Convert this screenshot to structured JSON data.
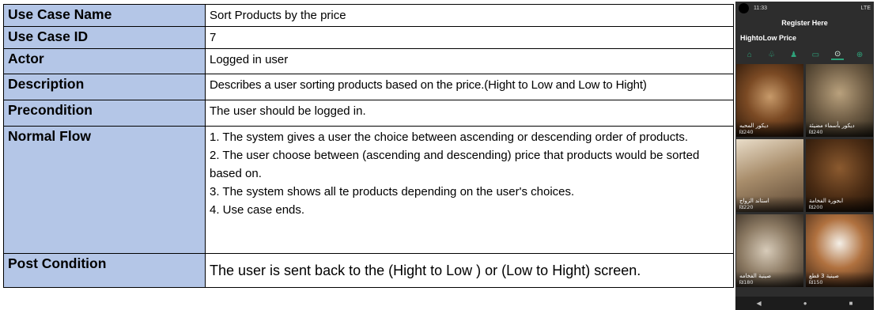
{
  "table": {
    "rows": [
      {
        "key": "Use Case Name",
        "value": "Sort Products by the price"
      },
      {
        "key": "Use Case ID",
        "value": "7"
      },
      {
        "key": "Actor",
        "value": "Logged in user"
      },
      {
        "key": "Description",
        "value": "Describes a user sorting products based on the price.(Hight to Low and Low to Hight)"
      },
      {
        "key": "Precondition",
        "value": "The user should be logged in."
      },
      {
        "key": "Normal Flow",
        "lines": [
          "1. The system gives a user the choice between ascending or descending order of products.",
          "2. The user choose between (ascending and descending) price that products would be sorted based on.",
          "3. The system shows all te products depending on the user's choices.",
          "4. Use case ends."
        ]
      },
      {
        "key": "Post Condition",
        "value": "The user is sent back to the (Hight to Low ) or (Low to Hight) screen."
      }
    ]
  },
  "phone": {
    "status_time": "11:33",
    "status_icons": "LTE",
    "header_title": "Register Here",
    "subtitle": "HightoLow Price",
    "tabs": [
      "home-icon",
      "category-icon",
      "person-icon",
      "cart-icon",
      "sort-icon",
      "sort-alt-icon"
    ],
    "products": [
      {
        "name": "ديكور المحبه",
        "price": "₪240"
      },
      {
        "name": "ديكور بأسماء مضيئة",
        "price": "₪240"
      },
      {
        "name": "استاند الزواج",
        "price": "₪220"
      },
      {
        "name": "ابجورة الفخامة",
        "price": "₪200"
      },
      {
        "name": "صينية الفخامه",
        "price": "₪180"
      },
      {
        "name": "صينية 3 قطع",
        "price": "₪150"
      }
    ],
    "nav": [
      "◀",
      "●",
      "■"
    ]
  }
}
